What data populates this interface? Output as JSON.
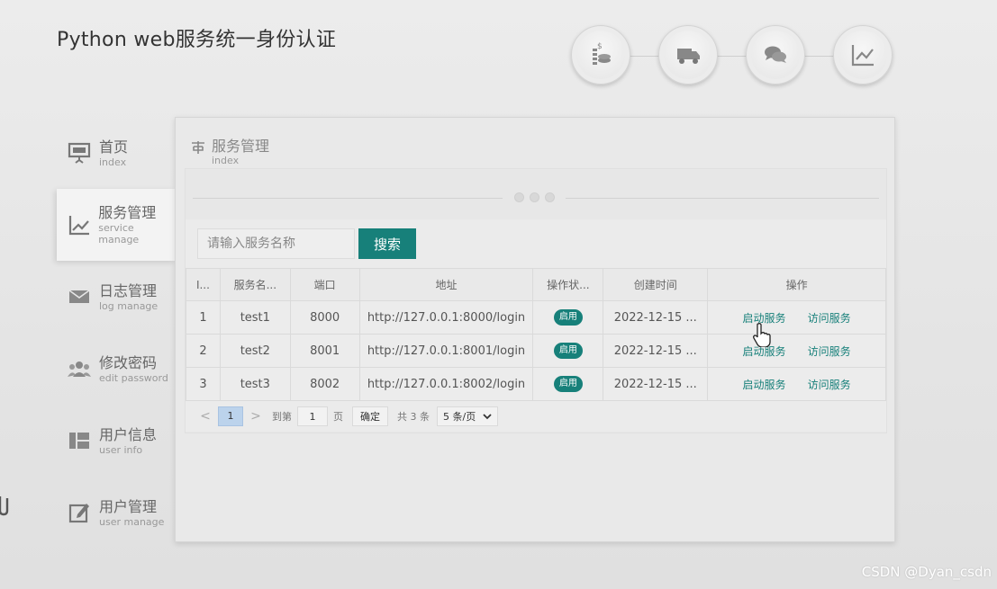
{
  "app": {
    "title": "Python web服务统一身份认证"
  },
  "top_icons": [
    "coins-icon",
    "truck-icon",
    "chat-icon",
    "chart-icon"
  ],
  "sidebar": {
    "items": [
      {
        "cn": "首页",
        "en": "index",
        "icon": "presentation-icon"
      },
      {
        "cn": "服务管理",
        "en": "service manage",
        "icon": "line-chart-icon",
        "active": true
      },
      {
        "cn": "日志管理",
        "en": "log manage",
        "icon": "envelope-icon"
      },
      {
        "cn": "修改密码",
        "en": "edit password",
        "icon": "users-icon"
      },
      {
        "cn": "用户信息",
        "en": "user info",
        "icon": "layout-icon"
      },
      {
        "cn": "用户管理",
        "en": "user manage",
        "icon": "edit-icon"
      }
    ]
  },
  "panel": {
    "title_cn": "服务管理",
    "title_en": "index"
  },
  "search": {
    "placeholder": "请输入服务名称",
    "button": "搜索"
  },
  "table": {
    "headers": [
      "I...",
      "服务名...",
      "端口",
      "地址",
      "操作状...",
      "创建时间",
      "操作"
    ],
    "rows": [
      {
        "id": "1",
        "name": "test1",
        "port": "8000",
        "url": "http://127.0.0.1:8000/login",
        "status": "启用",
        "created": "2022-12-15 ...",
        "op1": "启动服务",
        "op2": "访问服务"
      },
      {
        "id": "2",
        "name": "test2",
        "port": "8001",
        "url": "http://127.0.0.1:8001/login",
        "status": "启用",
        "created": "2022-12-15 ...",
        "op1": "启动服务",
        "op2": "访问服务"
      },
      {
        "id": "3",
        "name": "test3",
        "port": "8002",
        "url": "http://127.0.0.1:8002/login",
        "status": "启用",
        "created": "2022-12-15 ...",
        "op1": "启动服务",
        "op2": "访问服务"
      }
    ]
  },
  "pager": {
    "prev": "<",
    "current": "1",
    "next": ">",
    "goto_label": "到第",
    "goto_value": "1",
    "page_suffix": "页",
    "confirm": "确定",
    "total": "共 3 条",
    "page_size": "5 条/页"
  },
  "watermark": "CSDN @Dyan_csdn",
  "colors": {
    "accent": "#17807a",
    "pager_active": "#bcd3ec"
  }
}
